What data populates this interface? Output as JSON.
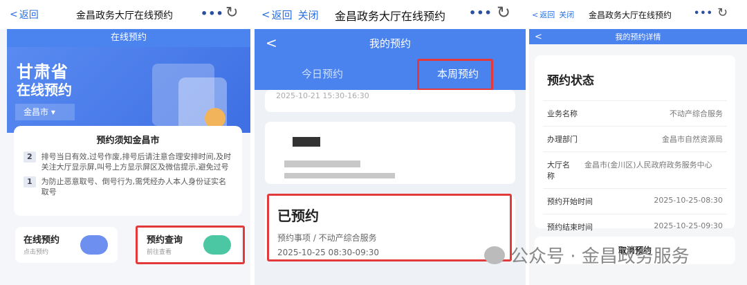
{
  "panel1": {
    "back_label": "返回",
    "title": "金昌政务大厅在线预约",
    "more_icon": "more-dots-icon",
    "refresh_icon": "refresh-icon",
    "hero_subtitle": "在线预约",
    "hero_line1": "甘肃省",
    "hero_line2": "在线预约",
    "city_select": "金昌市 ▾",
    "notice_title": "预约须知金昌市",
    "notices": [
      {
        "num": "2",
        "text": "排号当日有效,过号作废,排号后请注意合理安排时间,及时关注大厅显示屏,叫号上方显示屏区及微信提示,避免过号"
      },
      {
        "num": "1",
        "text": "为防止恶意取号、倒号行为,需凭经办人本人身份证实名取号"
      }
    ],
    "card_online": {
      "title": "在线预约",
      "sub": "点击预约"
    },
    "card_query": {
      "title": "预约查询",
      "sub": "前往查看"
    }
  },
  "panel2": {
    "back_label": "返回",
    "close_label": "关闭",
    "title": "金昌政务大厅在线预约",
    "page_title": "我的预约",
    "tab_today": "今日预约",
    "tab_week": "本周预约",
    "partial_time": "2025-10-21 15:30-16:30",
    "status": "已预约",
    "item": "预约事项 / 不动产综合服务",
    "time": "2025-10-25 08:30-09:30"
  },
  "panel3": {
    "back_label": "返回",
    "close_label": "关闭",
    "title": "金昌政务大厅在线预约",
    "page_title": "我的预约详情",
    "section": "预约状态",
    "rows": [
      {
        "k": "业务名称",
        "v": "不动产综合服务"
      },
      {
        "k": "办理部门",
        "v": "金昌市自然资源局"
      },
      {
        "k": "大厅名称",
        "v": "金昌市(金川区)人民政府政务服务中心"
      },
      {
        "k": "预约开始时间",
        "v": "2025-10-25-08:30"
      },
      {
        "k": "预约结束时间",
        "v": "2025-10-25-09:30"
      }
    ],
    "cancel": "取消预约"
  },
  "watermark": "公众号 · 金昌政务服务",
  "colors": {
    "accent": "#4a82ee",
    "highlight": "#e23a3a"
  }
}
